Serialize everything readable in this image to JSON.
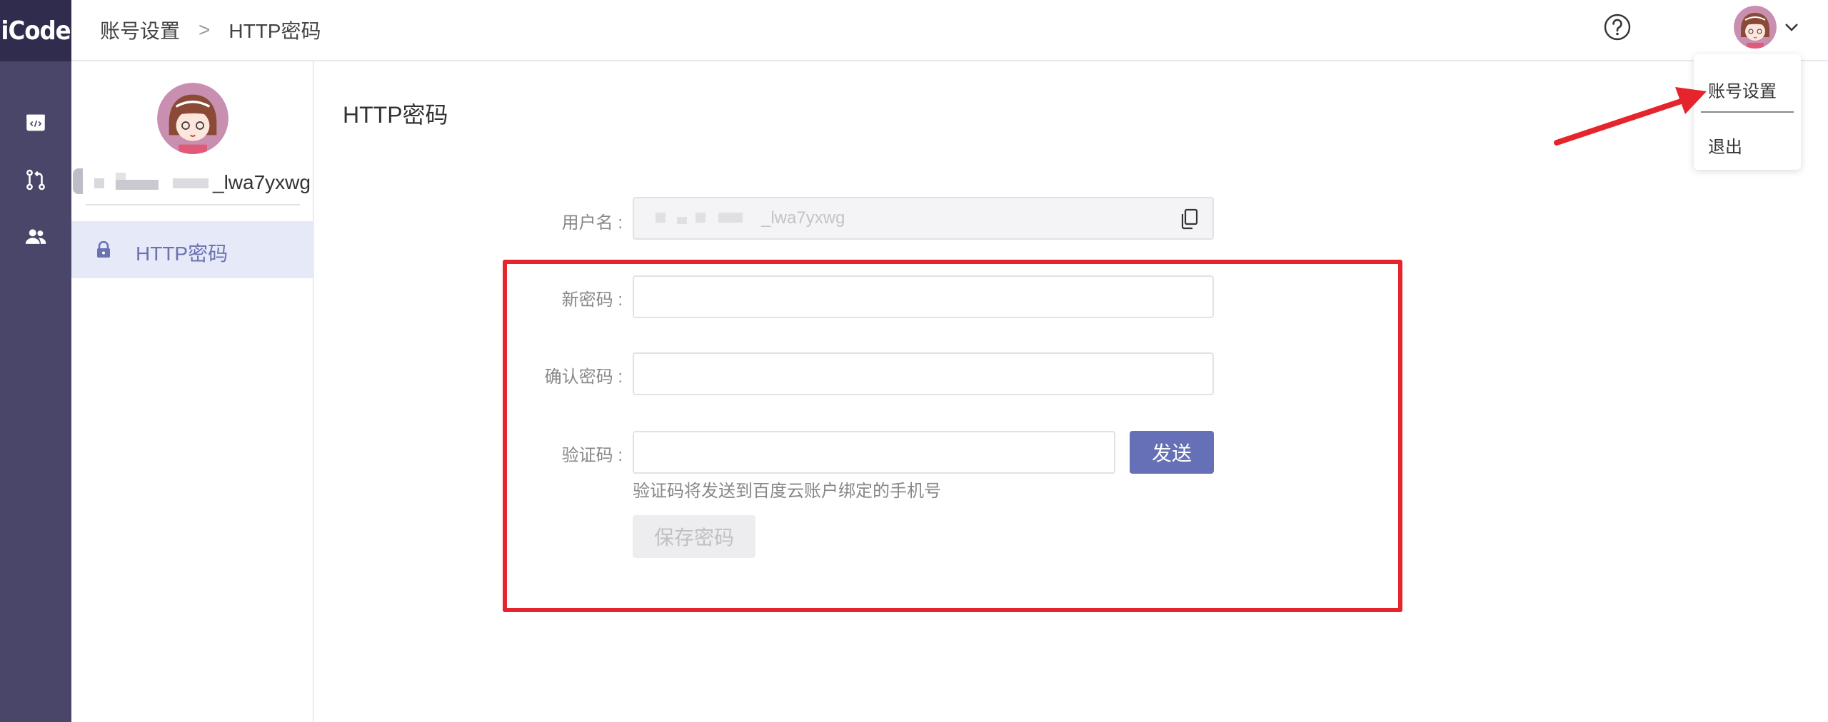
{
  "app": {
    "logo_text": "iCode"
  },
  "breadcrumb": {
    "root": "账号设置",
    "separator": ">",
    "current": "HTTP密码"
  },
  "header": {
    "help_icon": "help-circle-icon",
    "avatar_icon": "user-avatar",
    "chevron_icon": "chevron-down-icon"
  },
  "dropdown": {
    "items": [
      {
        "label": "账号设置"
      },
      {
        "label": "退出"
      }
    ]
  },
  "rail": {
    "icons": [
      "code-window-icon",
      "merge-request-icon",
      "people-icon"
    ]
  },
  "sidebar": {
    "username_suffix": "_lwa7yxwg",
    "items": [
      {
        "label": "HTTP密码",
        "icon": "lock-icon",
        "active": true
      }
    ]
  },
  "main": {
    "title": "HTTP密码",
    "form": {
      "username_label": "用户名 :",
      "username_value": "_lwa7yxwg",
      "new_password_label": "新密码 :",
      "new_password_value": "",
      "confirm_password_label": "确认密码 :",
      "confirm_password_value": "",
      "code_label": "验证码 :",
      "code_value": "",
      "send_label": "发送",
      "hint": "验证码将发送到百度云账户绑定的手机号",
      "save_label": "保存密码"
    }
  },
  "colors": {
    "rail": "#4a4669",
    "logo_bg": "#302c4d",
    "accent": "#6570b6",
    "annotation": "#e5242b"
  }
}
